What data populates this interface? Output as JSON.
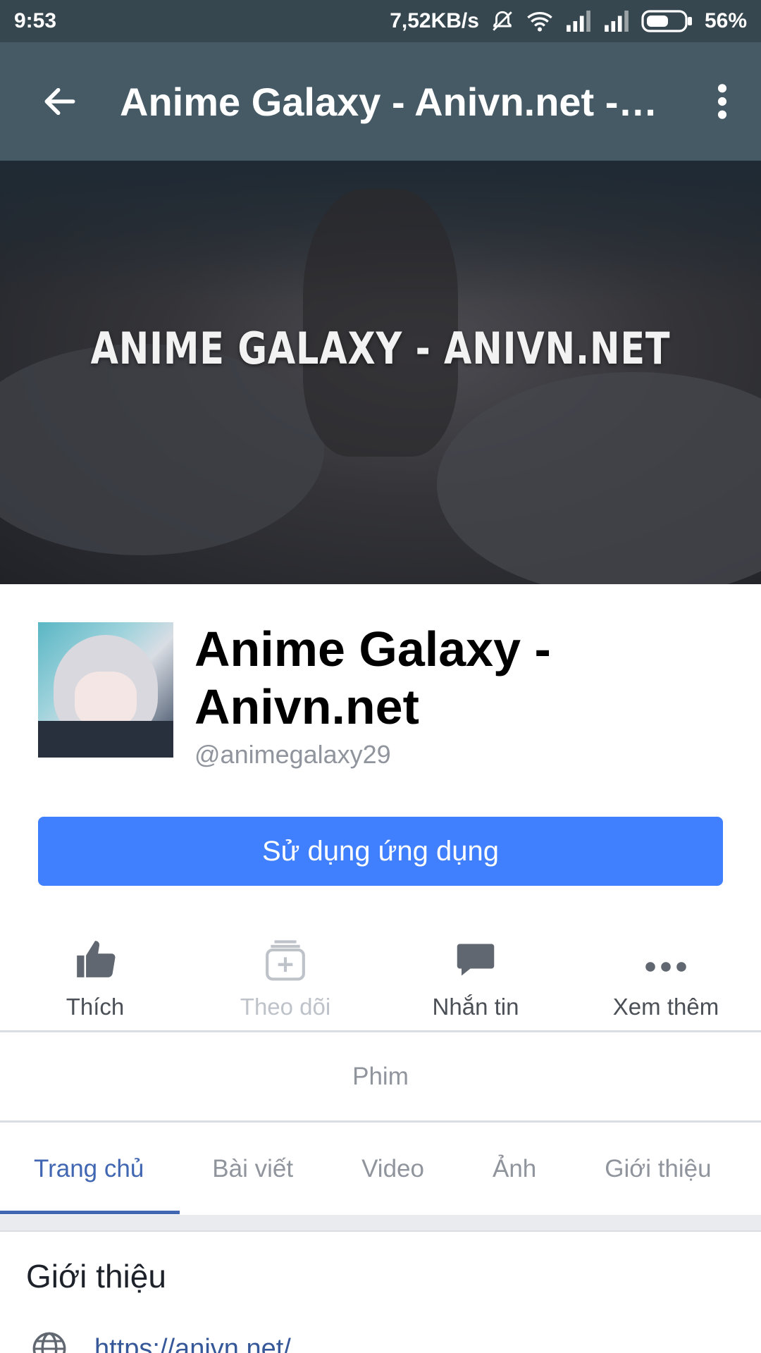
{
  "status_bar": {
    "time": "9:53",
    "network_speed": "7,52KB/s",
    "battery": "56%",
    "icons": [
      "bell-muted-icon",
      "wifi-icon",
      "signal-icon",
      "signal-icon",
      "battery-icon"
    ]
  },
  "app_bar": {
    "title": "Anime Galaxy - Anivn.net -…",
    "back_icon": "arrow-back-icon",
    "menu_icon": "more-vertical-icon"
  },
  "cover": {
    "text": "ANIME GALAXY - ANIVN.NET"
  },
  "profile": {
    "name": "Anime Galaxy - Anivn.net",
    "handle": "@animegalaxy29"
  },
  "cta": {
    "label": "Sử dụng ứng dụng",
    "color": "#4080ff"
  },
  "actions": [
    {
      "label": "Thích",
      "icon": "thumbs-up-icon",
      "enabled": true
    },
    {
      "label": "Theo dõi",
      "icon": "follow-icon",
      "enabled": false
    },
    {
      "label": "Nhắn tin",
      "icon": "message-icon",
      "enabled": true
    },
    {
      "label": "Xem thêm",
      "icon": "more-horizontal-icon",
      "enabled": true
    }
  ],
  "category": "Phim",
  "tabs": [
    {
      "label": "Trang chủ",
      "active": true
    },
    {
      "label": "Bài viết",
      "active": false
    },
    {
      "label": "Video",
      "active": false
    },
    {
      "label": "Ảnh",
      "active": false
    },
    {
      "label": "Giới thiệu",
      "active": false
    }
  ],
  "about": {
    "title": "Giới thiệu",
    "website": "https://anivn.net/",
    "website_icon": "globe-icon"
  },
  "colors": {
    "status_bar": "#37474f",
    "app_bar": "#455a64",
    "active_tab": "#4267b2",
    "link": "#365899"
  }
}
